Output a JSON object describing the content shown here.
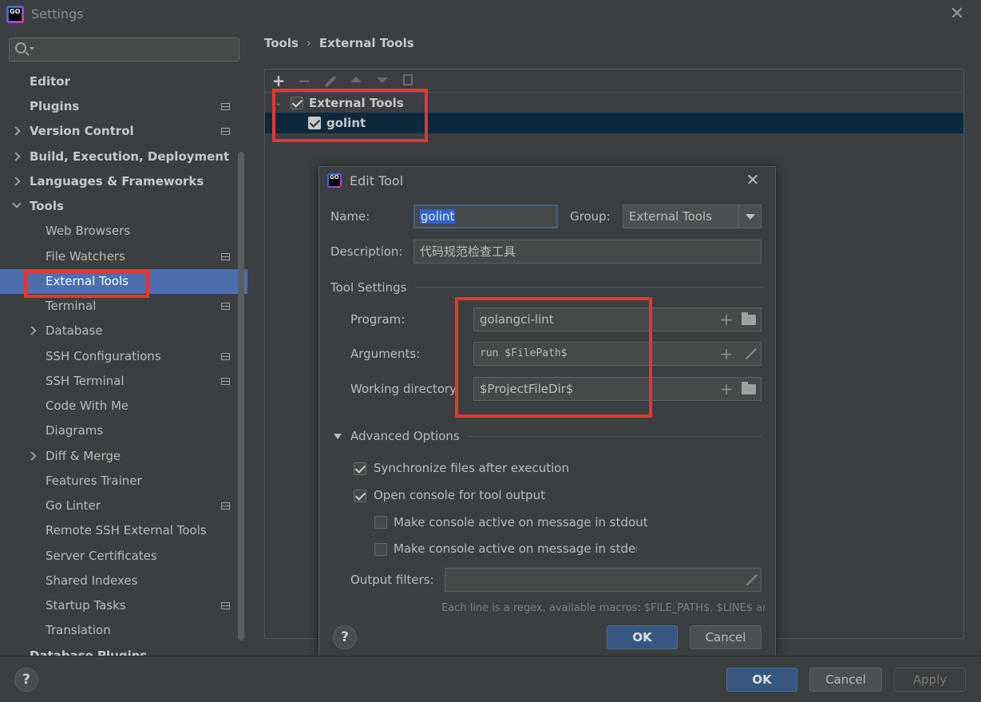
{
  "window": {
    "title": "Settings"
  },
  "search": {
    "placeholder": ""
  },
  "sidebar": {
    "items": [
      {
        "label": "Editor"
      },
      {
        "label": "Plugins"
      },
      {
        "label": "Version Control"
      },
      {
        "label": "Build, Execution, Deployment"
      },
      {
        "label": "Languages & Frameworks"
      },
      {
        "label": "Tools"
      },
      {
        "label": "Web Browsers"
      },
      {
        "label": "File Watchers"
      },
      {
        "label": "External Tools"
      },
      {
        "label": "Terminal"
      },
      {
        "label": "Database"
      },
      {
        "label": "SSH Configurations"
      },
      {
        "label": "SSH Terminal"
      },
      {
        "label": "Code With Me"
      },
      {
        "label": "Diagrams"
      },
      {
        "label": "Diff & Merge"
      },
      {
        "label": "Features Trainer"
      },
      {
        "label": "Go Linter"
      },
      {
        "label": "Remote SSH External Tools"
      },
      {
        "label": "Server Certificates"
      },
      {
        "label": "Shared Indexes"
      },
      {
        "label": "Startup Tasks"
      },
      {
        "label": "Translation"
      },
      {
        "label": "Database Plugins"
      }
    ]
  },
  "breadcrumb": {
    "parent": "Tools",
    "separator": "›",
    "current": "External Tools"
  },
  "tools_tree": {
    "group": "External Tools",
    "tool": "golint"
  },
  "dialog": {
    "title": "Edit Tool",
    "name_label": "Name:",
    "name_value": "golint",
    "group_label": "Group:",
    "group_value": "External Tools",
    "description_label": "Description:",
    "description_value": "代码规范检查工具",
    "tool_settings_title": "Tool Settings",
    "program_label": "Program:",
    "program_value": "golangci-lint",
    "arguments_label": "Arguments:",
    "arguments_value": "run $FilePath$",
    "workdir_label": "Working directory:",
    "workdir_value": "$ProjectFileDir$",
    "advanced_title": "Advanced Options",
    "sync_label": "Synchronize files after execution",
    "console_label": "Open console for tool output",
    "stdout_label": "Make console active on message in stdout",
    "stderr_label": "Make console active on message in stderr",
    "output_filters_label": "Output filters:",
    "output_filters_value": "",
    "hint": "Each line is a regex, available macros: $FILE_PATH$, $LINE$ and ...",
    "help": "?",
    "ok": "OK",
    "cancel": "Cancel"
  },
  "footer": {
    "help": "?",
    "ok": "OK",
    "cancel": "Cancel",
    "apply": "Apply"
  },
  "colors": {
    "selection": "#4b6eaf",
    "highlight_box": "#e8352e",
    "primary_button": "#365880"
  }
}
